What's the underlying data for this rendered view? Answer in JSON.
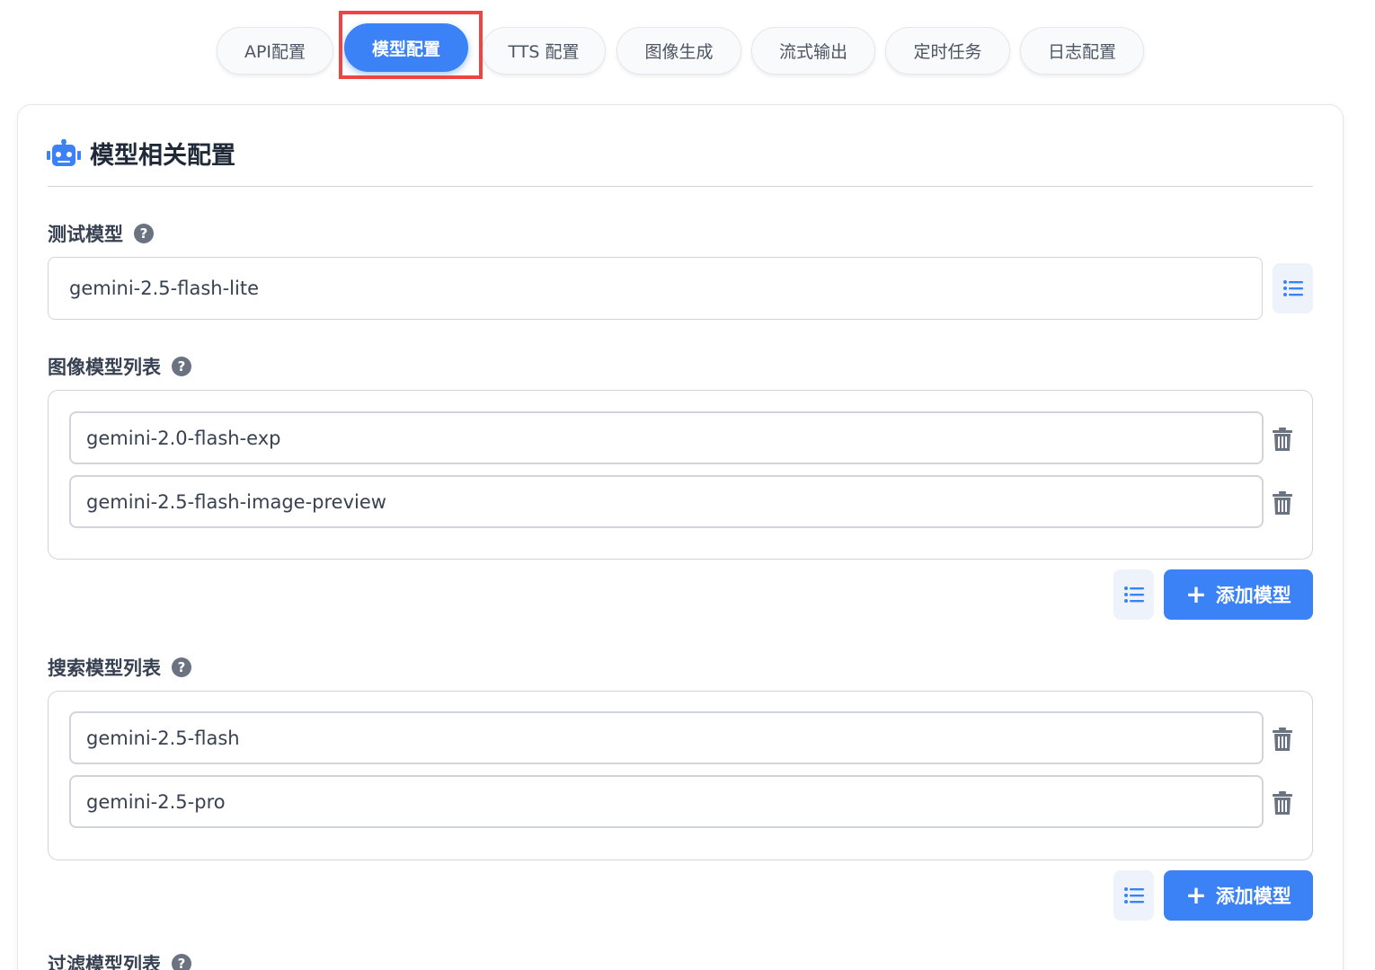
{
  "tabs": [
    {
      "label": "API配置"
    },
    {
      "label": "模型配置"
    },
    {
      "label": "TTS 配置"
    },
    {
      "label": "图像生成"
    },
    {
      "label": "流式输出"
    },
    {
      "label": "定时任务"
    },
    {
      "label": "日志配置"
    }
  ],
  "section": {
    "title": "模型相关配置"
  },
  "test_model": {
    "label": "测试模型",
    "value": "gemini-2.5-flash-lite"
  },
  "image_models": {
    "label": "图像模型列表",
    "items": [
      "gemini-2.0-flash-exp",
      "gemini-2.5-flash-image-preview"
    ],
    "add_label": "添加模型"
  },
  "search_models": {
    "label": "搜索模型列表",
    "items": [
      "gemini-2.5-flash",
      "gemini-2.5-pro"
    ],
    "add_label": "添加模型"
  },
  "filter_models": {
    "label": "过滤模型列表"
  },
  "help_glyph": "?",
  "plus_glyph": "+",
  "colors": {
    "accent": "#3b82f6",
    "highlight": "#ef4444"
  }
}
